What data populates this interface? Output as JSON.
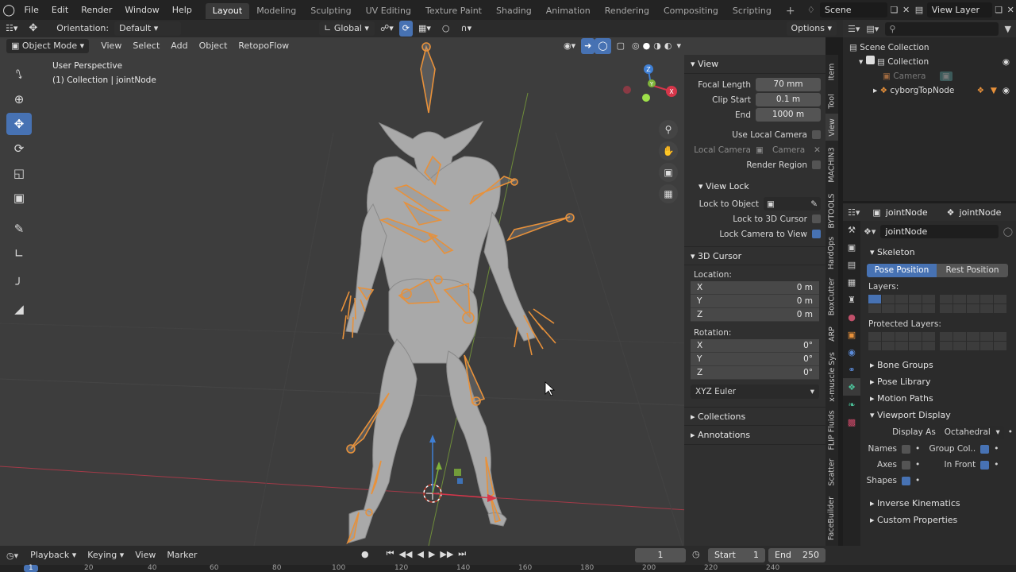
{
  "topbar": {
    "menus": [
      "File",
      "Edit",
      "Render",
      "Window",
      "Help"
    ],
    "workspaces": [
      "Layout",
      "Modeling",
      "Sculpting",
      "UV Editing",
      "Texture Paint",
      "Shading",
      "Animation",
      "Rendering",
      "Compositing",
      "Scripting"
    ],
    "add_tab": "+",
    "scene": "Scene",
    "view_layer": "View Layer"
  },
  "toolheader": {
    "orientation_label": "Orientation:",
    "orientation_value": "Default",
    "transform_orientation": "Global",
    "options": "Options"
  },
  "viewheader": {
    "mode": "Object Mode",
    "menus": [
      "View",
      "Select",
      "Add",
      "Object",
      "RetopoFlow"
    ]
  },
  "viewport": {
    "perspective": "User Perspective",
    "collection": "(1) Collection | jointNode",
    "gizmo": {
      "x": "X",
      "y": "Y",
      "z": "Z"
    },
    "colors": {
      "bone": "#e8913a",
      "mesh": "#b8b8b8",
      "x_axis": "#c23a4c",
      "y_axis": "#7fa33a",
      "bg": "#3d3d3d"
    }
  },
  "npanel": {
    "view_header": "View",
    "focal_length": {
      "label": "Focal Length",
      "value": "70 mm"
    },
    "clip_start": {
      "label": "Clip Start",
      "value": "0.1 m"
    },
    "clip_end": {
      "label": "End",
      "value": "1000 m"
    },
    "use_local_camera": "Use Local Camera",
    "local_camera": {
      "label": "Local Camera",
      "value": "Camera"
    },
    "render_region": "Render Region",
    "view_lock_header": "View Lock",
    "lock_to_object": "Lock to Object",
    "lock_to_cursor": "Lock to 3D Cursor",
    "lock_camera": "Lock Camera to View",
    "cursor_header": "3D Cursor",
    "location_label": "Location:",
    "location": [
      {
        "axis": "X",
        "value": "0 m"
      },
      {
        "axis": "Y",
        "value": "0 m"
      },
      {
        "axis": "Z",
        "value": "0 m"
      }
    ],
    "rotation_label": "Rotation:",
    "rotation": [
      {
        "axis": "X",
        "value": "0°"
      },
      {
        "axis": "Y",
        "value": "0°"
      },
      {
        "axis": "Z",
        "value": "0°"
      }
    ],
    "rotation_mode": "XYZ Euler",
    "collections_header": "Collections",
    "annotations_header": "Annotations"
  },
  "vtabs": [
    "Item",
    "Tool",
    "View",
    "MACHIN3",
    "BYTOOLS",
    "HardOps",
    "BoxCutter",
    "ARP",
    "x-muscle Sys",
    "FLIP Fluids",
    "Scatter",
    "FaceBuilder"
  ],
  "outliner": {
    "scene_collection": "Scene Collection",
    "collection": "Collection",
    "camera": "Camera",
    "node": "cyborgTopNode"
  },
  "properties": {
    "object_name": "jointNode",
    "data_name": "jointNode",
    "armature_field": "jointNode",
    "skeleton_header": "Skeleton",
    "pose_position": "Pose Position",
    "rest_position": "Rest Position",
    "layers_label": "Layers:",
    "protected_layers_label": "Protected Layers:",
    "bone_groups": "Bone Groups",
    "pose_library": "Pose Library",
    "motion_paths": "Motion Paths",
    "viewport_display": "Viewport Display",
    "display_as_label": "Display As",
    "display_as_value": "Octahedral",
    "names": "Names",
    "group_colors": "Group Col..",
    "axes": "Axes",
    "in_front": "In Front",
    "shapes": "Shapes",
    "inverse_kinematics": "Inverse Kinematics",
    "custom_properties": "Custom Properties"
  },
  "timeline": {
    "playback": "Playback",
    "keying": "Keying",
    "view": "View",
    "marker": "Marker",
    "current_frame": "1",
    "start_label": "Start",
    "start_value": "1",
    "end_label": "End",
    "end_value": "250",
    "ruler_ticks": [
      "1",
      "20",
      "40",
      "60",
      "80",
      "100",
      "120",
      "140",
      "160",
      "180",
      "200",
      "220",
      "240"
    ]
  }
}
